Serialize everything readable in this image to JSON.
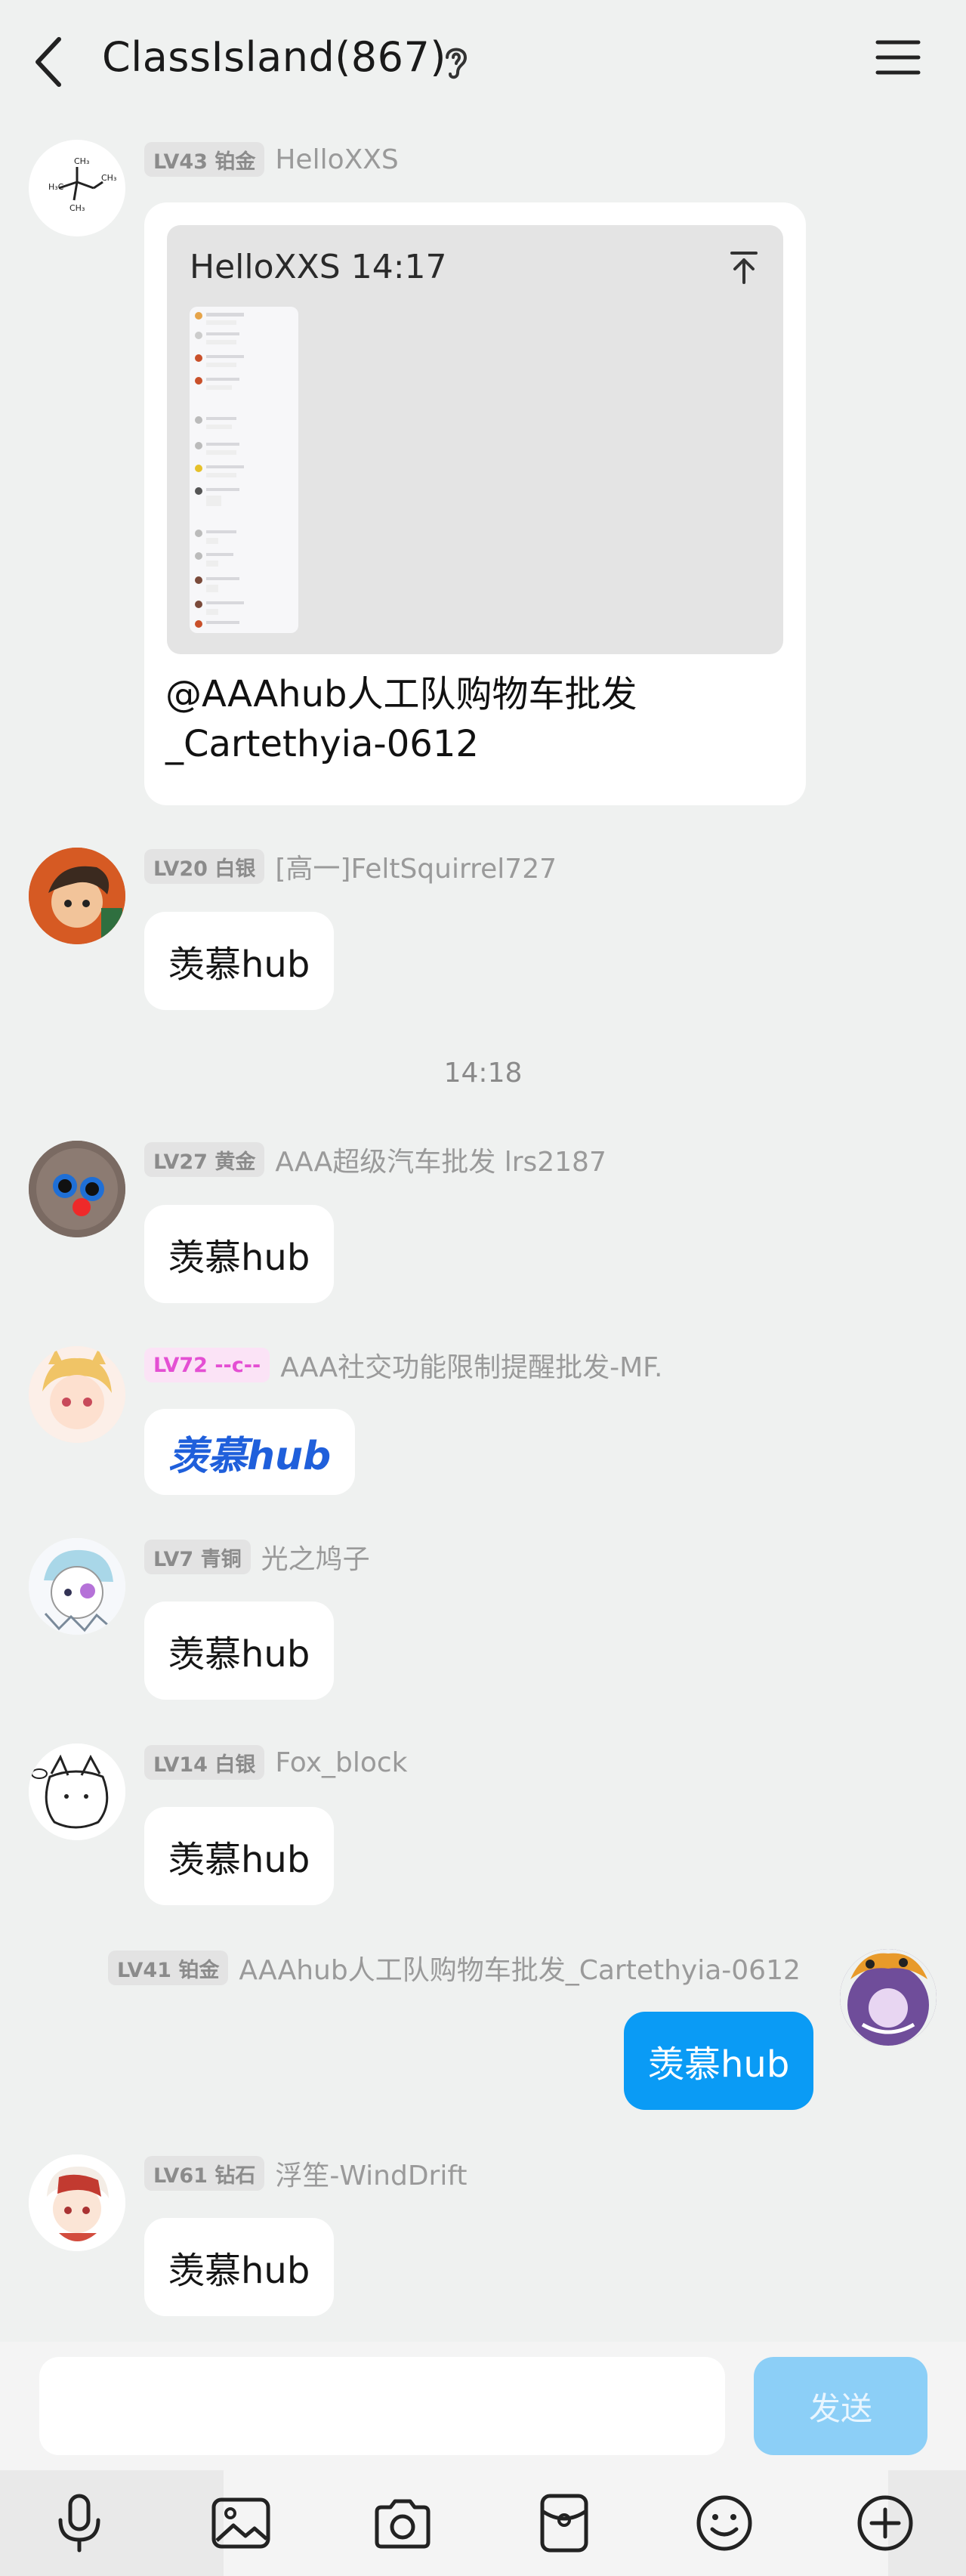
{
  "header": {
    "title": "ClassIsland(867)"
  },
  "quoted_message": {
    "author_level": "LV43 铂金",
    "author_name": "HelloXXS",
    "quote_header": "HelloXXS 14:17",
    "text_line1": "@AAAhub人工队购物车批发",
    "text_line2": "_Cartethyia-0612"
  },
  "messages": [
    {
      "level": "LV20 白银",
      "name": "[高一]FeltSquirrel727",
      "text": "羡慕hub"
    },
    {
      "level": "LV27 黄金",
      "name": "AAA超级汽车批发 lrs2187",
      "text": "羡慕hub"
    },
    {
      "level": "LV72 ‑‑c‑‑",
      "name": "AAA社交功能限制提醒批发-MF.",
      "text": "羡慕hub"
    },
    {
      "level": "LV7 青铜",
      "name": "光之鸠子",
      "text": "羡慕hub"
    },
    {
      "level": "LV14 白银",
      "name": "Fox_block",
      "text": "羡慕hub"
    },
    {
      "level": "LV41 铂金",
      "name": "AAAhub人工队购物车批发_Cartethyia-0612",
      "text": "羡慕hub"
    },
    {
      "level": "LV61 钻石",
      "name": "浮笙-WindDrift",
      "text": "羡慕hub"
    }
  ],
  "time_divider": "14:18",
  "composer": {
    "placeholder": "",
    "send_label": "发送"
  },
  "colors": {
    "background": "#eff1f0",
    "sent_bubble": "#0a9bf5",
    "send_button": "#8ccff7"
  },
  "toolbar_icons": [
    "microphone-icon",
    "image-icon",
    "camera-icon",
    "red-packet-icon",
    "emoji-icon",
    "plus-icon"
  ]
}
